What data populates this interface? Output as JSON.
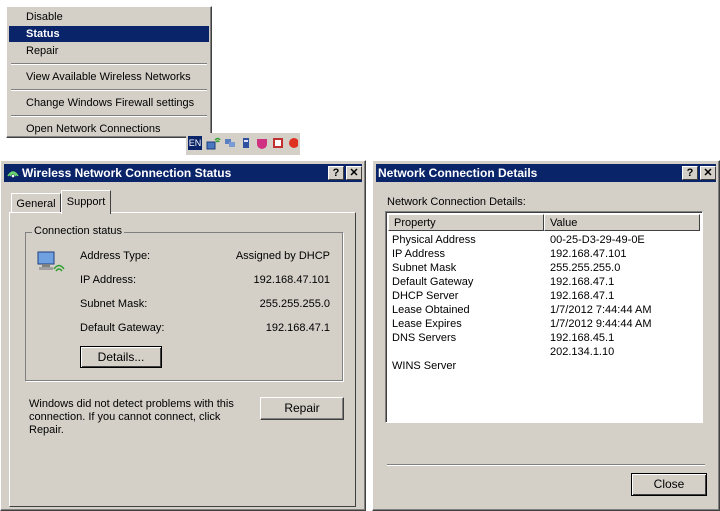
{
  "context_menu": {
    "items": [
      {
        "label": "Disable"
      },
      {
        "label": "Status"
      },
      {
        "label": "Repair"
      },
      {
        "label": "View Available Wireless Networks"
      },
      {
        "label": "Change Windows Firewall settings"
      },
      {
        "label": "Open Network Connections"
      }
    ]
  },
  "tray": {
    "language": "EN"
  },
  "status_window": {
    "title": "Wireless Network Connection Status",
    "tabs": [
      {
        "label": "General"
      },
      {
        "label": "Support"
      }
    ],
    "group_label": "Connection status",
    "rows": [
      {
        "label": "Address Type:",
        "value": "Assigned by DHCP"
      },
      {
        "label": "IP Address:",
        "value": "192.168.47.101"
      },
      {
        "label": "Subnet Mask:",
        "value": "255.255.255.0"
      },
      {
        "label": "Default Gateway:",
        "value": "192.168.47.1"
      }
    ],
    "details_button": "Details...",
    "message": "Windows did not detect problems with this connection. If you cannot connect, click Repair.",
    "repair_button": "Repair"
  },
  "details_window": {
    "title": "Network Connection Details",
    "caption": "Network Connection Details:",
    "columns": [
      "Property",
      "Value"
    ],
    "rows": [
      {
        "property": "Physical Address",
        "value": "00-25-D3-29-49-0E"
      },
      {
        "property": "IP Address",
        "value": "192.168.47.101"
      },
      {
        "property": "Subnet Mask",
        "value": "255.255.255.0"
      },
      {
        "property": "Default Gateway",
        "value": "192.168.47.1"
      },
      {
        "property": "DHCP Server",
        "value": "192.168.47.1"
      },
      {
        "property": "Lease Obtained",
        "value": "1/7/2012 7:44:44 AM"
      },
      {
        "property": "Lease Expires",
        "value": "1/7/2012 9:44:44 AM"
      },
      {
        "property": "DNS Servers",
        "value": "192.168.45.1"
      },
      {
        "property": "",
        "value": "202.134.1.10"
      },
      {
        "property": "WINS Server",
        "value": ""
      }
    ],
    "close_button": "Close"
  },
  "colors": {
    "titlebar": "#0a246a",
    "face": "#d4d0c8",
    "selection": "#0a246a"
  }
}
